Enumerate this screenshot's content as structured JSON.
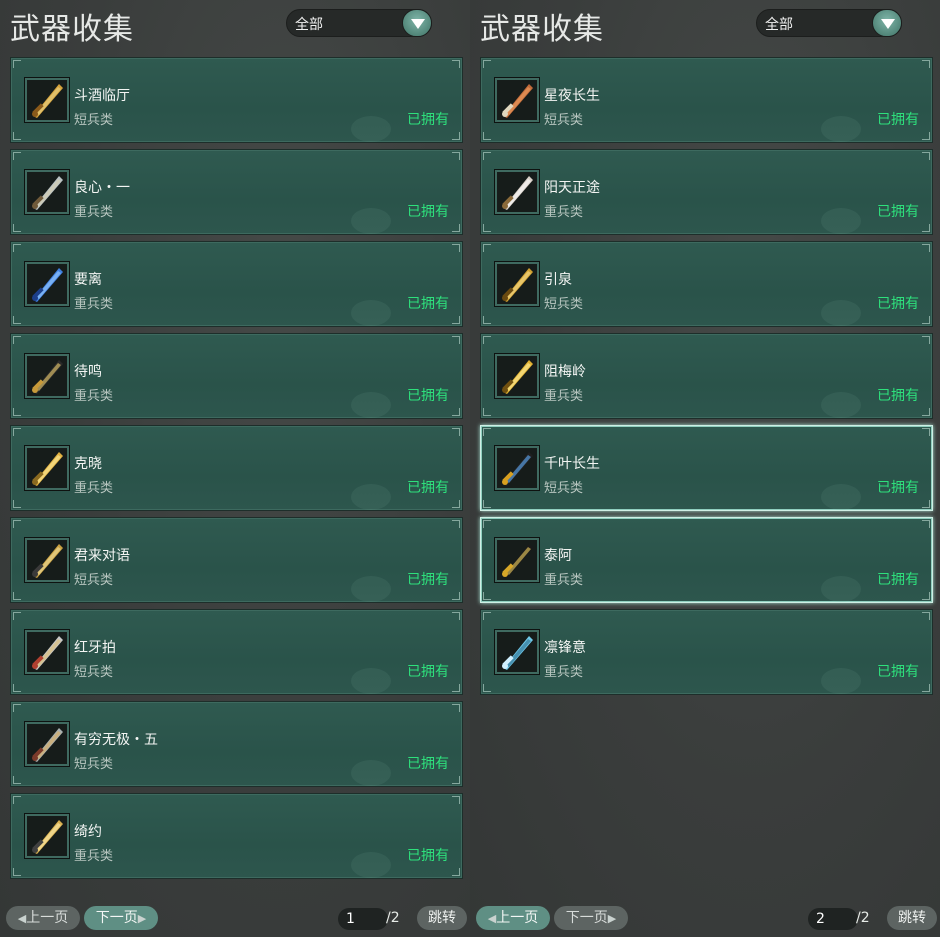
{
  "panels": [
    {
      "title": "武器收集",
      "filter": "全部",
      "items": [
        {
          "name": "斗酒临厅",
          "type": "短兵类",
          "status": "已拥有",
          "icon": "gold-ornate-sword-icon",
          "selected": false
        },
        {
          "name": "良心・一",
          "type": "重兵类",
          "status": "已拥有",
          "icon": "twin-blade-icon",
          "selected": false
        },
        {
          "name": "要离",
          "type": "重兵类",
          "status": "已拥有",
          "icon": "blue-crystal-blade-icon",
          "selected": false
        },
        {
          "name": "待鸣",
          "type": "重兵类",
          "status": "已拥有",
          "icon": "dark-gold-blade-icon",
          "selected": false
        },
        {
          "name": "克晓",
          "type": "重兵类",
          "status": "已拥有",
          "icon": "golden-blade-icon",
          "selected": false
        },
        {
          "name": "君来对语",
          "type": "短兵类",
          "status": "已拥有",
          "icon": "slim-gold-sword-icon",
          "selected": false
        },
        {
          "name": "红牙拍",
          "type": "短兵类",
          "status": "已拥有",
          "icon": "red-hilt-sword-icon",
          "selected": false
        },
        {
          "name": "有穷无极・五",
          "type": "短兵类",
          "status": "已拥有",
          "icon": "ornate-dagger-icon",
          "selected": false
        },
        {
          "name": "绮约",
          "type": "重兵类",
          "status": "已拥有",
          "icon": "gold-striped-blade-icon",
          "selected": false
        }
      ],
      "pager": {
        "prev": "上一页",
        "next": "下一页",
        "page": "1",
        "total": "/2",
        "jump": "跳转"
      }
    },
    {
      "title": "武器收集",
      "filter": "全部",
      "items": [
        {
          "name": "星夜长生",
          "type": "短兵类",
          "status": "已拥有",
          "icon": "starry-dagger-icon",
          "selected": false
        },
        {
          "name": "阳天正途",
          "type": "重兵类",
          "status": "已拥有",
          "icon": "silver-blade-icon",
          "selected": false
        },
        {
          "name": "引泉",
          "type": "短兵类",
          "status": "已拥有",
          "icon": "golden-crossbow-icon",
          "selected": false
        },
        {
          "name": "阻梅岭",
          "type": "重兵类",
          "status": "已拥有",
          "icon": "gold-spear-icon",
          "selected": false
        },
        {
          "name": "千叶长生",
          "type": "短兵类",
          "status": "已拥有",
          "icon": "jeweled-rod-icon",
          "selected": true
        },
        {
          "name": "泰阿",
          "type": "重兵类",
          "status": "已拥有",
          "icon": "black-gold-blade-icon",
          "selected": true
        },
        {
          "name": "凛锋意",
          "type": "重兵类",
          "status": "已拥有",
          "icon": "ice-blade-icon",
          "selected": false
        }
      ],
      "pager": {
        "prev": "上一页",
        "next": "下一页",
        "page": "2",
        "total": "/2",
        "jump": "跳转"
      }
    }
  ],
  "colors": {
    "card_bg": "#2d564d",
    "status_green": "#2ee07c",
    "accent": "#5f8f84"
  }
}
